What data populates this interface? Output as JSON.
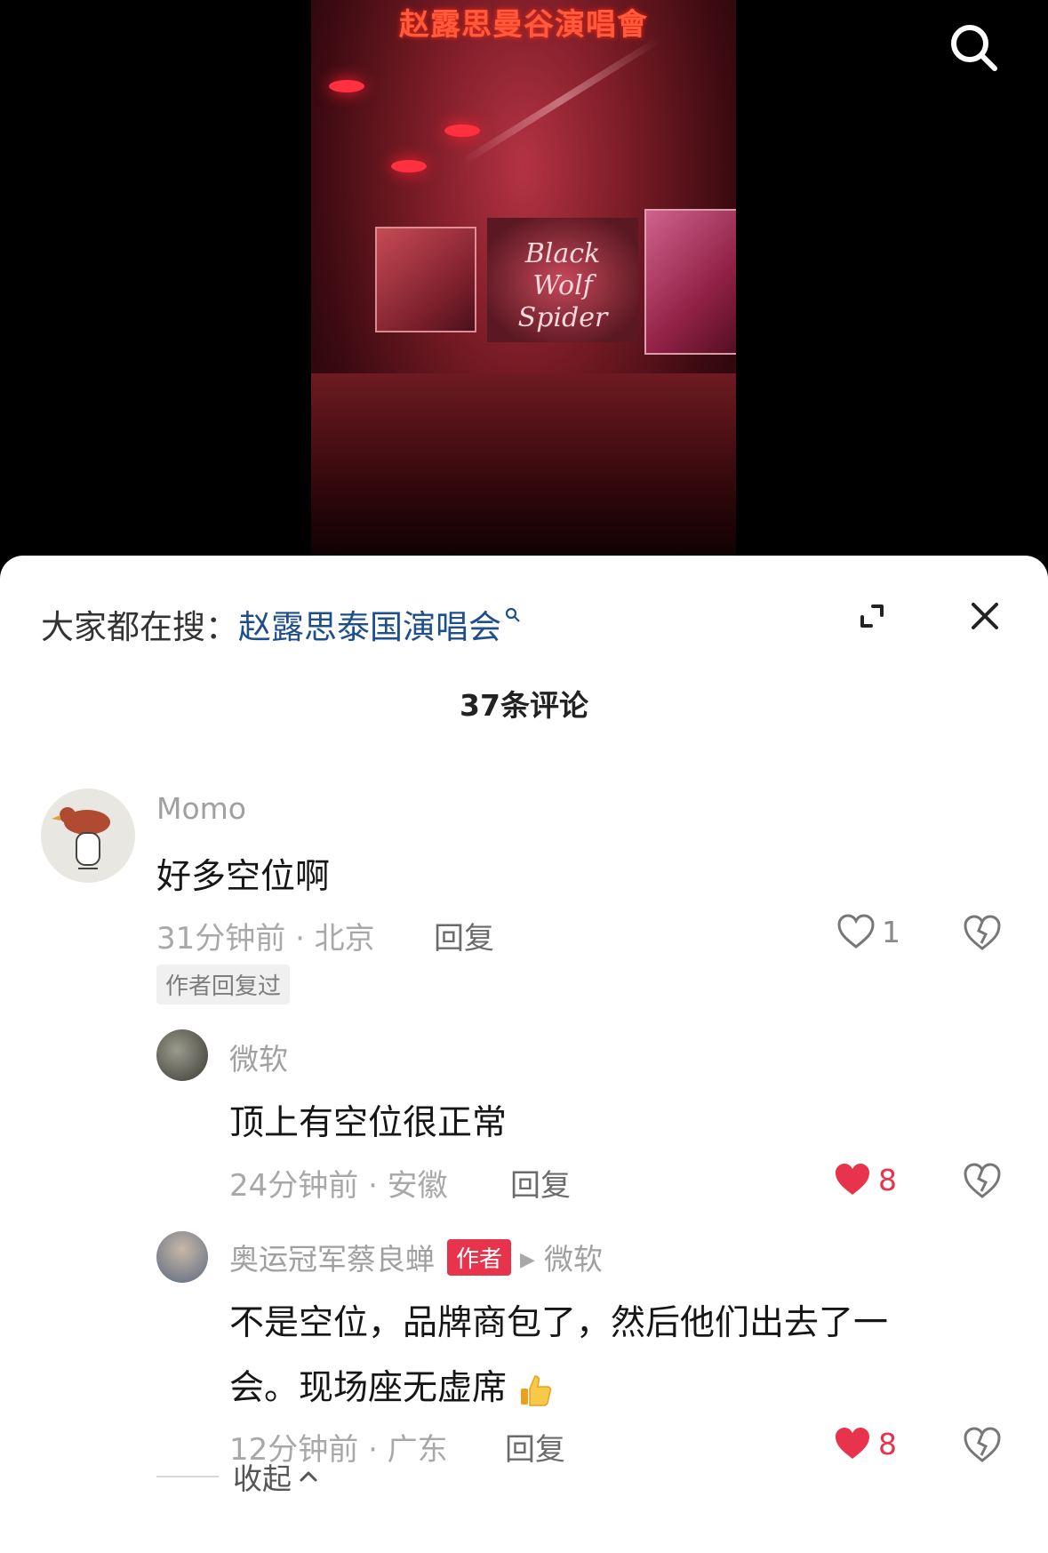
{
  "video": {
    "title": "赵露思曼谷演唱會",
    "stage_logo_line1": "Black",
    "stage_logo_line2": "Wolf Spider"
  },
  "hot_search": {
    "label": "大家都在搜：",
    "keyword": "赵露思泰国演唱会"
  },
  "comments_header": {
    "count_label": "37条评论"
  },
  "comments": [
    {
      "username": "Momo",
      "text": "好多空位啊",
      "time_location": "31分钟前 · 北京",
      "reply_label": "回复",
      "likes": "1",
      "badge": "作者回复过"
    },
    {
      "username": "微软",
      "text": "顶上有空位很正常",
      "time_location": "24分钟前 · 安徽",
      "reply_label": "回复",
      "likes": "8"
    },
    {
      "username": "奥运冠军蔡良蝉",
      "author_tag": "作者",
      "reply_to": "微软",
      "text_line1": "不是空位，品牌商包了，然后他们出去了一",
      "text_line2": "会。现场座无虚席",
      "time_location": "12分钟前 · 广东",
      "reply_label": "回复",
      "likes": "8"
    }
  ],
  "collapse": {
    "label": "收起"
  },
  "colors": {
    "accent_red": "#e8334d",
    "link_blue": "#1f4f8a",
    "sheet_bg": "#ffffff"
  },
  "icons": [
    "search-icon",
    "expand-icon",
    "close-icon",
    "heart-icon",
    "heart-filled-icon",
    "dislike-icon",
    "thumbs-up-icon",
    "chevron-up-icon"
  ]
}
